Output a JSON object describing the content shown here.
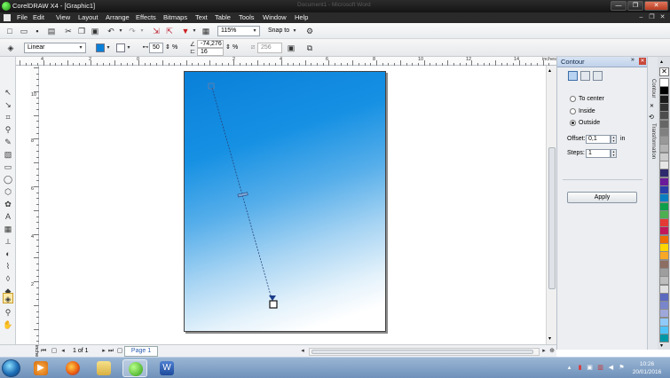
{
  "window": {
    "title": "CorelDRAW X4 - [Graphic1]",
    "background_title": "Document1 - Microsoft Word",
    "minimize": "—",
    "maximize": "❐",
    "close": "✕"
  },
  "menu": {
    "items": [
      "File",
      "Edit",
      "View",
      "Layout",
      "Arrange",
      "Effects",
      "Bitmaps",
      "Text",
      "Table",
      "Tools",
      "Window",
      "Help"
    ],
    "mdi_minimize": "–",
    "mdi_restore": "❐",
    "mdi_close": "✕"
  },
  "toolbar": {
    "zoom_level": "115%",
    "snap_to": "Snap to"
  },
  "property_bar": {
    "fill_type": "Linear",
    "midpoint": "50",
    "midpoint_unit": "%",
    "angle": "-74,276",
    "edge_pad": "16",
    "edge_pad_unit": "%",
    "steps": "256"
  },
  "ruler": {
    "unit": "inches",
    "top_labels": [
      "4",
      "2",
      "0",
      "2",
      "4",
      "6",
      "8",
      "10",
      "12",
      "14"
    ],
    "left_labels": [
      "10",
      "8",
      "6",
      "4",
      "2"
    ]
  },
  "status": {
    "page_count": "1 of 1",
    "page_tab": "Page 1",
    "units_label": "inches"
  },
  "docker": {
    "title": "Contour",
    "options": [
      {
        "label": "To center",
        "checked": false
      },
      {
        "label": "Inside",
        "checked": false
      },
      {
        "label": "Outside",
        "checked": true
      }
    ],
    "offset_label": "Offset:",
    "offset_value": "0,1",
    "offset_unit": "in",
    "steps_label": "Steps:",
    "steps_value": "1",
    "apply_label": "Apply",
    "side_tabs": [
      "Contour",
      "Transformation"
    ]
  },
  "palette": {
    "colors": [
      "#ffffff",
      "#000000",
      "#1a1a1a",
      "#333333",
      "#4d4d4d",
      "#666666",
      "#808080",
      "#999999",
      "#b3b3b3",
      "#cccccc",
      "#e6e6e6",
      "#2e2a6e",
      "#6a1b9a",
      "#2a3eaa",
      "#0b7ec1",
      "#0d9f4a",
      "#4caf50",
      "#e53935",
      "#c2185b",
      "#ef6c00",
      "#ffd600",
      "#f9a825",
      "#8d6e63",
      "#9e9e9e",
      "#bdbdbd",
      "#e0e0e0",
      "#5c6bc0",
      "#7986cb",
      "#9fa8da",
      "#90caf9",
      "#4fc3f7",
      "#0097a7"
    ]
  },
  "taskbar": {
    "time": "10:26",
    "date": "20/01/2016"
  }
}
